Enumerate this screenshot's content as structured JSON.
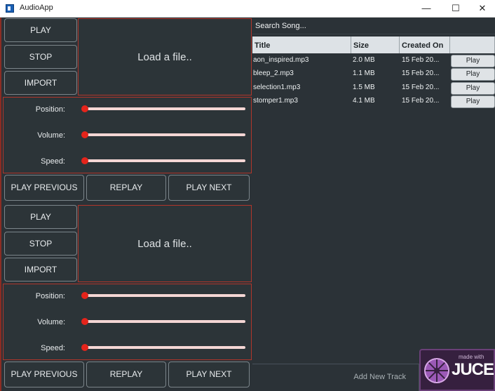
{
  "window": {
    "title": "AudioApp",
    "minimize_glyph": "—",
    "maximize_glyph": "☐",
    "close_glyph": "✕"
  },
  "decks": [
    {
      "play_label": "PLAY",
      "stop_label": "STOP",
      "import_label": "IMPORT",
      "load_text": "Load a file..",
      "sliders": [
        {
          "label": "Position:",
          "value": 0.0
        },
        {
          "label": "Volume:",
          "value": 0.0
        },
        {
          "label": "Speed:",
          "value": 0.0
        }
      ],
      "play_previous_label": "PLAY PREVIOUS",
      "replay_label": "REPLAY",
      "play_next_label": "PLAY NEXT"
    },
    {
      "play_label": "PLAY",
      "stop_label": "STOP",
      "import_label": "IMPORT",
      "load_text": "Load a file..",
      "sliders": [
        {
          "label": "Position:",
          "value": 0.0
        },
        {
          "label": "Volume:",
          "value": 0.0
        },
        {
          "label": "Speed:",
          "value": 0.0
        }
      ],
      "play_previous_label": "PLAY PREVIOUS",
      "replay_label": "REPLAY",
      "play_next_label": "PLAY NEXT"
    }
  ],
  "library": {
    "search_text": "Search Song...",
    "columns": [
      "Title",
      "Size",
      "Created On"
    ],
    "rows": [
      {
        "title": "aon_inspired.mp3",
        "size": "2.0 MB",
        "created": "15 Feb 20...",
        "action": "Play"
      },
      {
        "title": "bleep_2.mp3",
        "size": "1.1 MB",
        "created": "15 Feb 20...",
        "action": "Play"
      },
      {
        "title": "selection1.mp3",
        "size": "1.5 MB",
        "created": "15 Feb 20...",
        "action": "Play"
      },
      {
        "title": "stomper1.mp3",
        "size": "4.1 MB",
        "created": "15 Feb 20...",
        "action": "Play"
      }
    ],
    "add_track_label": "Add New Track"
  },
  "branding": {
    "made_with": "made with",
    "name": "JUCE"
  },
  "colors": {
    "accent": "#e5241b",
    "panel_border": "#b2362b",
    "background": "#2b3237",
    "juce_purple": "#36203f"
  }
}
